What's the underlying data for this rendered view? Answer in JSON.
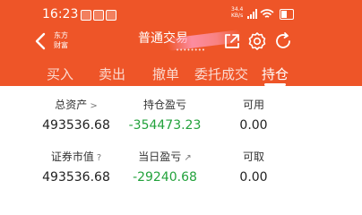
{
  "status_bar": {
    "time": "16:23",
    "network_top": "34.4",
    "network_bottom": "KB/s"
  },
  "header": {
    "logo_line1": "东方",
    "logo_line2": "财富",
    "title": "普通交易",
    "subtitle": "••••••••"
  },
  "tabs": [
    {
      "label": "买入"
    },
    {
      "label": "卖出"
    },
    {
      "label": "撤单"
    },
    {
      "label": "委托成交"
    },
    {
      "label": "持仓"
    }
  ],
  "active_tab": "持仓",
  "summary": {
    "total_assets": {
      "label": "总资产",
      "suffix": ">",
      "value": "493536.68"
    },
    "position_pnl": {
      "label": "持仓盈亏",
      "value": "-354473.23"
    },
    "available": {
      "label": "可用",
      "value": "0.00"
    },
    "market_value": {
      "label": "证券市值",
      "suffix": "?",
      "value": "493536.68"
    },
    "daily_pnl": {
      "label": "当日盈亏",
      "suffix": "↗",
      "value": "-29240.68"
    },
    "withdrawable": {
      "label": "可取",
      "value": "0.00"
    }
  },
  "colors": {
    "header_bg": "#ee5528",
    "loss_green": "#23a23c"
  }
}
